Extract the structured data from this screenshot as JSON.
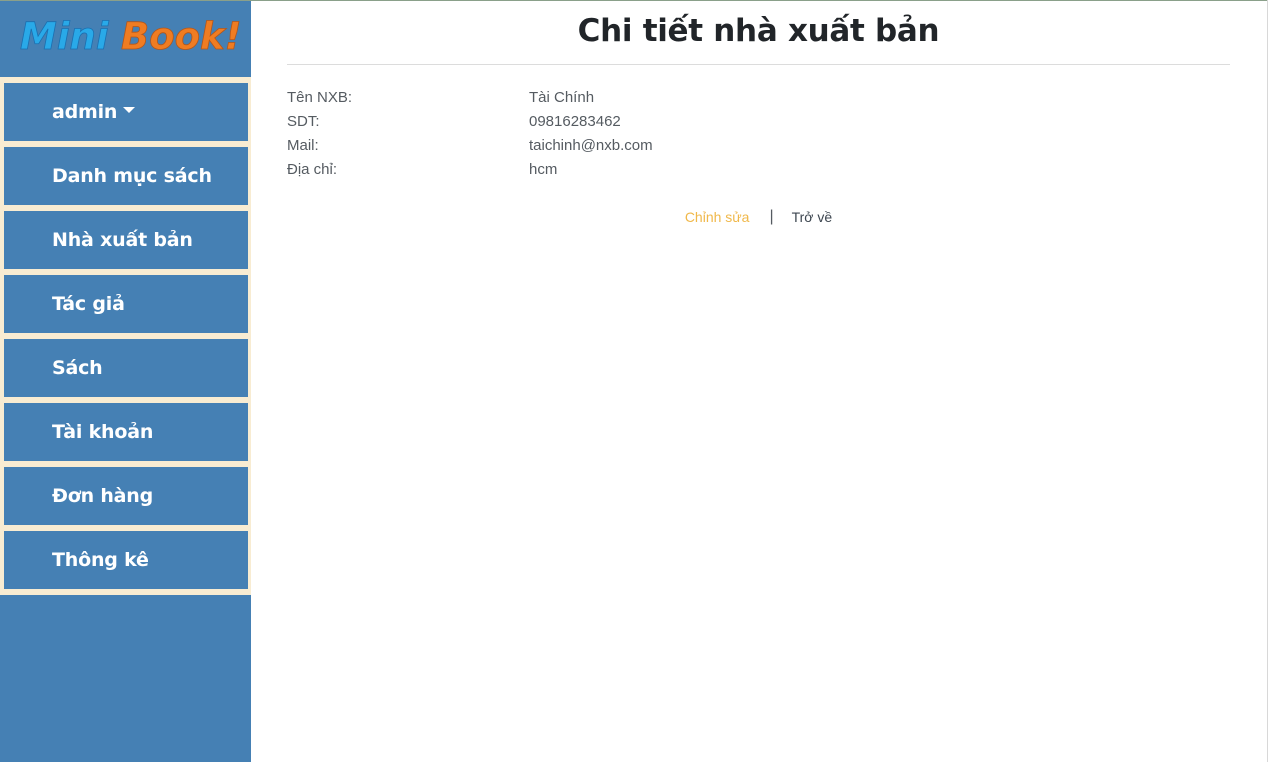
{
  "logo": {
    "part1": "Mini",
    "part2": "Book!",
    "color1": "#29a9e8",
    "color2": "#ef7c22"
  },
  "sidebar": {
    "items": [
      {
        "label": "admin",
        "has_dropdown": true
      },
      {
        "label": "Danh mục sách"
      },
      {
        "label": "Nhà xuất bản"
      },
      {
        "label": "Tác giả"
      },
      {
        "label": "Sách"
      },
      {
        "label": "Tài khoản"
      },
      {
        "label": "Đơn hàng"
      },
      {
        "label": "Thông kê"
      }
    ]
  },
  "main": {
    "title": "Chi tiết nhà xuất bản",
    "fields": [
      {
        "label": "Tên NXB:",
        "value": "Tài Chính"
      },
      {
        "label": "SDT:",
        "value": "09816283462"
      },
      {
        "label": "Mail:",
        "value": "taichinh@nxb.com"
      },
      {
        "label": "Địa chỉ:",
        "value": "hcm"
      }
    ],
    "actions": {
      "edit": "Chỉnh sửa",
      "separator": "|",
      "back": "Trở về"
    }
  },
  "colors": {
    "sidebar_bg": "#4580b4",
    "menu_gap": "#f8ecd2",
    "edit_link": "#f0b84a"
  }
}
